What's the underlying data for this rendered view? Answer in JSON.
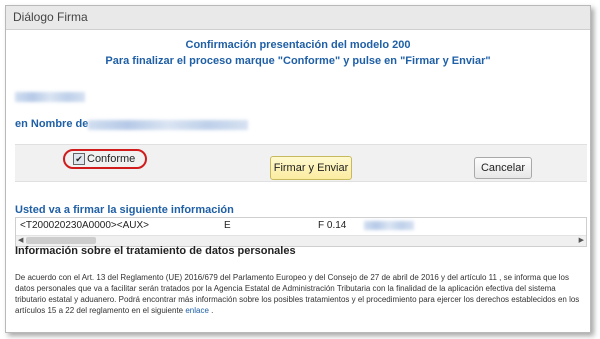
{
  "window": {
    "title": "Diálogo Firma"
  },
  "header": {
    "line1": "Confirmación presentación del modelo 200",
    "line2": "Para finalizar el proceso marque \"Conforme\" y pulse en \"Firmar y Enviar\""
  },
  "nombre": {
    "label": "en Nombre de"
  },
  "actions": {
    "conforme_label": "Conforme",
    "conforme_checked": true,
    "firmar_label": "Firmar y Enviar",
    "cancel_label": "Cancelar"
  },
  "info": {
    "title": "Usted va a firmar la siguiente información",
    "row": [
      "<T200020230A0000><AUX>",
      "E",
      "F 0.14"
    ]
  },
  "privacy": {
    "title": "Información sobre el tratamiento de datos personales",
    "text": "De acuerdo con el Art. 13 del Reglamento (UE) 2016/679 del Parlamento Europeo y del Consejo de 27 de abril de 2016 y del artículo 11 , se informa que los datos personales que va a facilitar serán tratados por la Agencia Estatal de Administración Tributaria con la finalidad de la aplicación efectiva del sistema tributario estatal y aduanero. Podrá encontrar más información sobre los posibles tratamientos y el procedimiento para ejercer los derechos establecidos en los artículos 15 a 22 del reglamento en el siguiente",
    "link": "enlace",
    "after_link": "."
  },
  "colors": {
    "accent": "#1f5fa6",
    "highlight": "#d01c1c"
  }
}
